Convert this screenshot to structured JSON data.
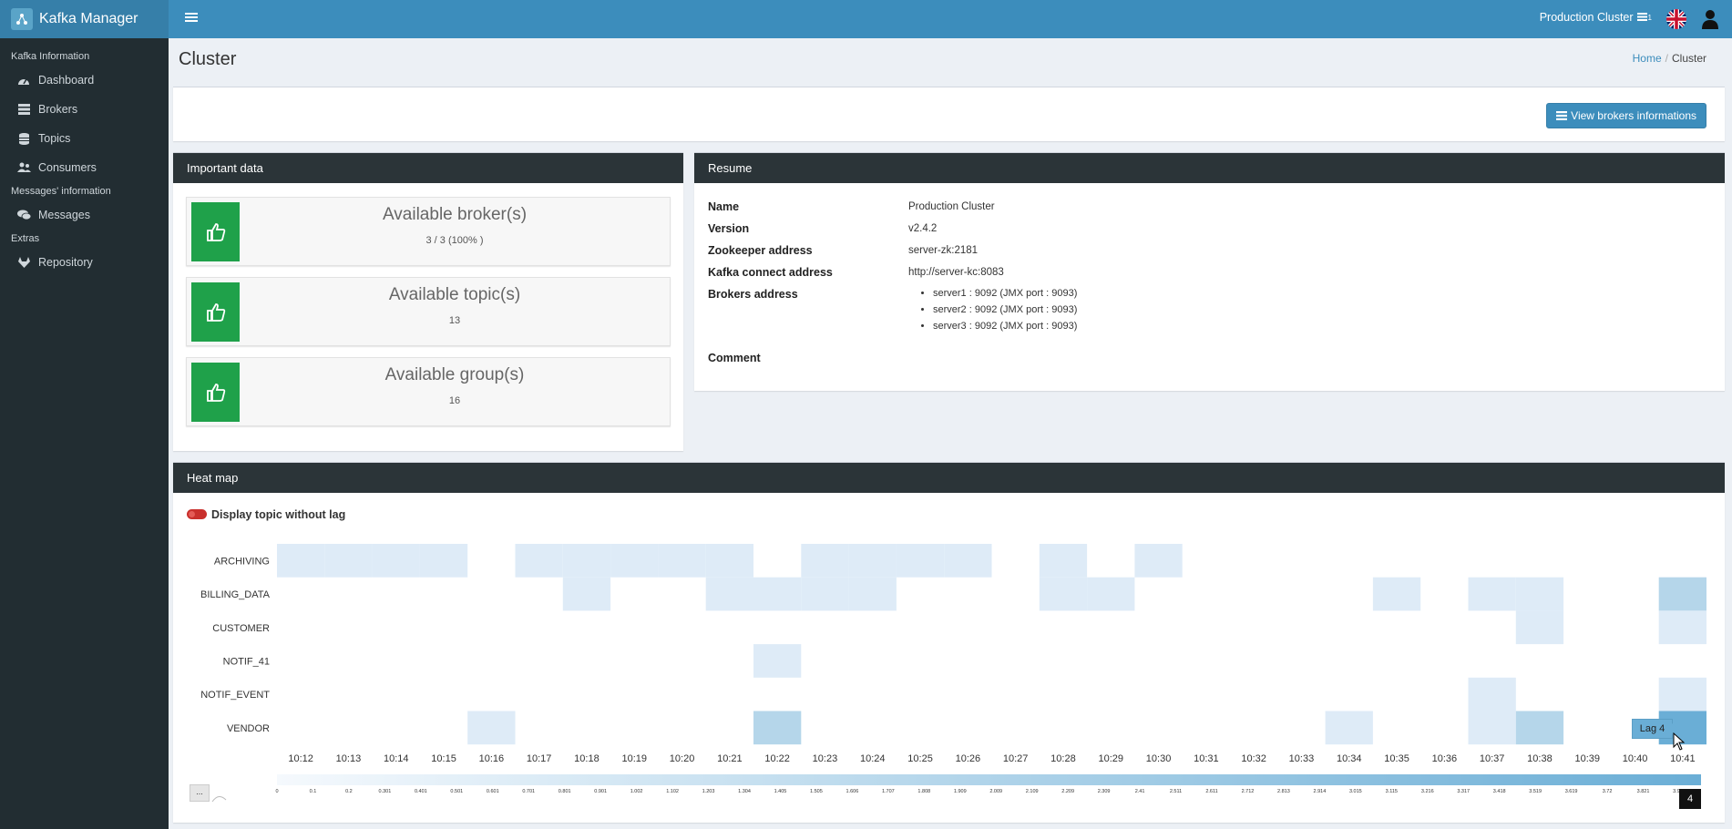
{
  "app": {
    "title": "Kafka Manager",
    "logo_icon": "kafka-logo-icon"
  },
  "sidebar": {
    "sections": [
      {
        "header": "Kafka Information",
        "items": [
          {
            "label": "Dashboard",
            "icon": "dashboard-icon"
          },
          {
            "label": "Brokers",
            "icon": "server-icon"
          },
          {
            "label": "Topics",
            "icon": "database-icon"
          },
          {
            "label": "Consumers",
            "icon": "users-icon"
          }
        ]
      },
      {
        "header": "Messages' information",
        "items": [
          {
            "label": "Messages",
            "icon": "comments-icon"
          }
        ]
      },
      {
        "header": "Extras",
        "items": [
          {
            "label": "Repository",
            "icon": "gitlab-icon"
          }
        ]
      }
    ]
  },
  "topbar": {
    "cluster": "Production Cluster",
    "cluster_badge": "1",
    "language_flag": "uk-flag-icon",
    "user_icon": "user-icon"
  },
  "page": {
    "title": "Cluster",
    "breadcrumb": {
      "home": "Home",
      "sep": "/",
      "current": "Cluster"
    }
  },
  "toolbar": {
    "view_brokers_label": "View brokers informations"
  },
  "important": {
    "title": "Important data",
    "stats": [
      {
        "label": "Available broker(s)",
        "value": "3 / 3 (100% )"
      },
      {
        "label": "Available topic(s)",
        "value": "13"
      },
      {
        "label": "Available group(s)",
        "value": "16"
      }
    ]
  },
  "resume": {
    "title": "Resume",
    "name_label": "Name",
    "name": "Production Cluster",
    "version_label": "Version",
    "version": "v2.4.2",
    "zookeeper_label": "Zookeeper address",
    "zookeeper": "server-zk:2181",
    "connect_label": "Kafka connect address",
    "connect": "http://server-kc:8083",
    "brokers_label": "Brokers address",
    "brokers": [
      "server1 : 9092 (JMX port : 9093)",
      "server2 : 9092 (JMX port : 9093)",
      "server3 : 9092 (JMX port : 9093)"
    ],
    "comment_label": "Comment"
  },
  "heatmap": {
    "title": "Heat map",
    "toggle_label": "Display topic without lag",
    "tooltip": "Lag 4",
    "legend_more": "...",
    "legend_max": "4",
    "legend_ticks": [
      "0",
      "0.1",
      "0.2",
      "0.301",
      "0.401",
      "0.501",
      "0.601",
      "0.701",
      "0.801",
      "0.901",
      "1.002",
      "1.102",
      "1.203",
      "1.304",
      "1.405",
      "1.505",
      "1.606",
      "1.707",
      "1.808",
      "1.909",
      "2.009",
      "2.109",
      "2.209",
      "2.309",
      "2.41",
      "2.511",
      "2.611",
      "2.712",
      "2.813",
      "2.914",
      "3.015",
      "3.115",
      "3.216",
      "3.317",
      "3.418",
      "3.519",
      "3.619",
      "3.72",
      "3.821",
      "3.922"
    ],
    "colors": {
      "low": "#deebf7",
      "mid": "#b5d6ea",
      "high": "#8cc1e2",
      "max": "#6aaed6"
    }
  },
  "chart_data": {
    "type": "heatmap",
    "title": "Heat map",
    "x": [
      "10:12",
      "10:13",
      "10:14",
      "10:15",
      "10:16",
      "10:17",
      "10:18",
      "10:19",
      "10:20",
      "10:21",
      "10:22",
      "10:23",
      "10:24",
      "10:25",
      "10:26",
      "10:27",
      "10:28",
      "10:29",
      "10:30",
      "10:31",
      "10:32",
      "10:33",
      "10:34",
      "10:35",
      "10:36",
      "10:37",
      "10:38",
      "10:39",
      "10:40",
      "10:41"
    ],
    "y": [
      "ARCHIVING",
      "BILLING_DATA",
      "CUSTOMER",
      "NOTIF_41",
      "NOTIF_EVENT",
      "VENDOR"
    ],
    "values": [
      [
        1,
        1,
        1,
        1,
        0,
        1,
        1,
        1,
        1,
        1,
        0,
        1,
        1,
        1,
        1,
        0,
        1,
        0,
        1,
        0,
        0,
        0,
        0,
        0,
        0,
        0,
        0,
        0,
        0,
        0
      ],
      [
        0,
        0,
        0,
        0,
        0,
        0,
        1,
        0,
        0,
        1,
        1,
        1,
        1,
        0,
        0,
        0,
        1,
        1,
        0,
        0,
        0,
        0,
        0,
        1,
        0,
        1,
        1,
        0,
        0,
        2
      ],
      [
        0,
        0,
        0,
        0,
        0,
        0,
        0,
        0,
        0,
        0,
        0,
        0,
        0,
        0,
        0,
        0,
        0,
        0,
        0,
        0,
        0,
        0,
        0,
        0,
        0,
        0,
        1,
        0,
        0,
        1
      ],
      [
        0,
        0,
        0,
        0,
        0,
        0,
        0,
        0,
        0,
        0,
        1,
        0,
        0,
        0,
        0,
        0,
        0,
        0,
        0,
        0,
        0,
        0,
        0,
        0,
        0,
        0,
        0,
        0,
        0,
        0
      ],
      [
        0,
        0,
        0,
        0,
        0,
        0,
        0,
        0,
        0,
        0,
        0,
        0,
        0,
        0,
        0,
        0,
        0,
        0,
        0,
        0,
        0,
        0,
        0,
        0,
        0,
        1,
        0,
        0,
        0,
        1
      ],
      [
        0,
        0,
        0,
        0,
        1,
        0,
        0,
        0,
        0,
        0,
        2,
        0,
        0,
        0,
        0,
        0,
        0,
        0,
        0,
        0,
        0,
        0,
        1,
        0,
        0,
        1,
        2,
        0,
        0,
        4
      ]
    ],
    "zlim": [
      0,
      4
    ]
  }
}
